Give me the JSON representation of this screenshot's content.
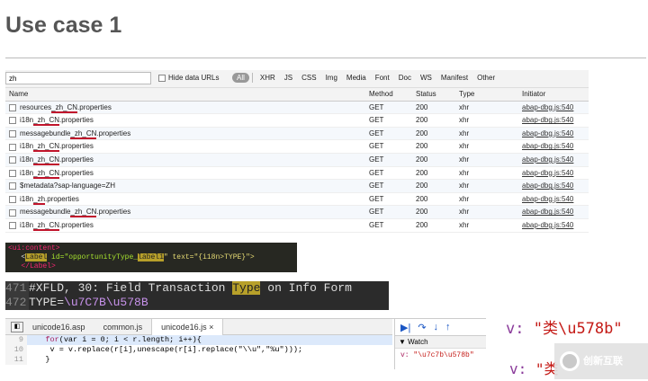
{
  "slide": {
    "title": "Use case 1"
  },
  "network": {
    "filter_value": "zh",
    "hide_data_urls": "Hide data URLs",
    "types": [
      "All",
      "XHR",
      "JS",
      "CSS",
      "Img",
      "Media",
      "Font",
      "Doc",
      "WS",
      "Manifest",
      "Other"
    ],
    "columns": {
      "name": "Name",
      "method": "Method",
      "status": "Status",
      "type": "Type",
      "initiator": "Initiator"
    },
    "rows": [
      {
        "name": "resources_zh_CN.properties",
        "method": "GET",
        "status": "200",
        "type": "xhr",
        "initiator": "abap-dbg.js:540"
      },
      {
        "name": "i18n_zh_CN.properties",
        "method": "GET",
        "status": "200",
        "type": "xhr",
        "initiator": "abap-dbg.js:540"
      },
      {
        "name": "messagebundle_zh_CN.properties",
        "method": "GET",
        "status": "200",
        "type": "xhr",
        "initiator": "abap-dbg.js:540"
      },
      {
        "name": "i18n_zh_CN.properties",
        "method": "GET",
        "status": "200",
        "type": "xhr",
        "initiator": "abap-dbg.js:540"
      },
      {
        "name": "i18n_zh_CN.properties",
        "method": "GET",
        "status": "200",
        "type": "xhr",
        "initiator": "abap-dbg.js:540"
      },
      {
        "name": "i18n_zh_CN.properties",
        "method": "GET",
        "status": "200",
        "type": "xhr",
        "initiator": "abap-dbg.js:540"
      },
      {
        "name": "$metadata?sap-language=ZH",
        "method": "GET",
        "status": "200",
        "type": "xhr",
        "initiator": "abap-dbg.js:540"
      },
      {
        "name": "i18n_zh.properties",
        "method": "GET",
        "status": "200",
        "type": "xhr",
        "initiator": "abap-dbg.js:540"
      },
      {
        "name": "messagebundle_zh_CN.properties",
        "method": "GET",
        "status": "200",
        "type": "xhr",
        "initiator": "abap-dbg.js:540"
      },
      {
        "name": "i18n_zh_CN.properties",
        "method": "GET",
        "status": "200",
        "type": "xhr",
        "initiator": "abap-dbg.js:540"
      }
    ]
  },
  "xml_snippet": {
    "line1": "<ui:content>",
    "line2_pre": "<",
    "line2_tag": "Label",
    "line2_attr": " id=\"opportunityType_",
    "line2_hl": "label1",
    "line2_rest": "\" text=\"{i18n>TYPE}\">",
    "line3": "</Label>"
  },
  "properties_file": {
    "line1_no": "471",
    "line1_pre": "#XFLD, 30: Field Transaction ",
    "line1_hl": "Type",
    "line1_post": " on Info Form",
    "line2_no": "472",
    "line2_key": "TYPE=",
    "line2_val": "\\u7C7B\\u578B"
  },
  "debugger": {
    "tabs": [
      "unicode16.asp",
      "common.js",
      "unicode16.js ×"
    ],
    "lines": [
      {
        "no": "9",
        "code_kw": "for",
        "code_rest": "(var i = 0; i < r.length; i++){"
      },
      {
        "no": "10",
        "code_kw": "",
        "code_rest": "    v = v.replace(r[i],unescape(r[i].replace(\"\\\\u\",\"%u\")));"
      },
      {
        "no": "11",
        "code_kw": "",
        "code_rest": "}"
      }
    ],
    "watch_label": "Watch",
    "watch_key": "v:",
    "watch_value": "\"\\u7c7b\\u578b\""
  },
  "callouts": {
    "c1_key": "v:",
    "c1_value": "\"类\\u578b\"",
    "c2_key": "v:",
    "c2_value": "\"类"
  },
  "watermark": {
    "brand": "创新互联"
  }
}
